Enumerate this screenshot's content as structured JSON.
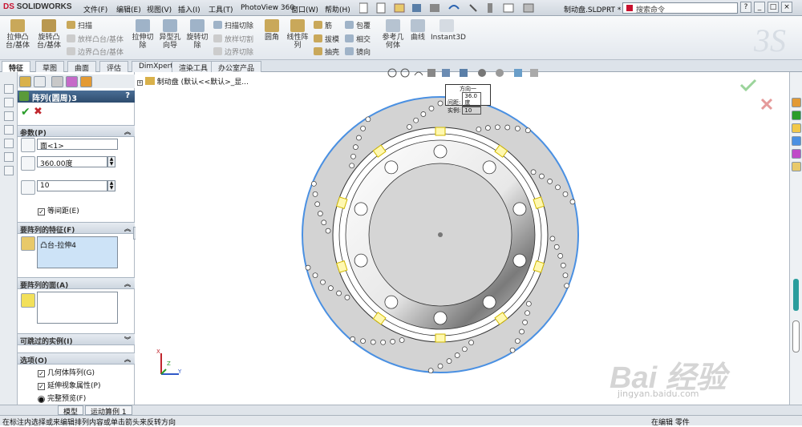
{
  "app": {
    "logo_ds": "DS",
    "logo": "SOLIDWORKS",
    "doc_title": "制动盘.SLDPRT *"
  },
  "menu": [
    "文件(F)",
    "编辑(E)",
    "视图(V)",
    "插入(I)",
    "工具(T)",
    "PhotoView 360",
    "窗口(W)",
    "帮助(H)"
  ],
  "search": {
    "placeholder": "搜索命令"
  },
  "window_buttons": [
    "?",
    "_",
    "□",
    "×"
  ],
  "ribbon": {
    "big": [
      "拉伸凸台/基体",
      "旋转凸台/基体",
      "拉伸切除",
      "异型孔向导",
      "旋转切除",
      "圆角",
      "线性阵列",
      "参考几何体",
      "曲线",
      "Instant3D"
    ],
    "small": [
      "扫描",
      "放样凸台/基体",
      "边界凸台/基体",
      "扫描切除",
      "放样切割",
      "边界切除",
      "筋",
      "包覆",
      "拔模",
      "相交",
      "抽壳",
      "镜向"
    ]
  },
  "tabs": [
    "特征",
    "草图",
    "曲面",
    "评估",
    "DimXpert",
    "渲染工具",
    "办公室产品"
  ],
  "tree_root": "制动盘 (默认<<默认>_显...",
  "panel": {
    "title": "阵列(圆周)3",
    "ok": "✔",
    "cancel": "✖",
    "help": "?",
    "params": {
      "header": "参数(P)",
      "axis": "面<1>",
      "angle": "360.00度",
      "count": "10",
      "equal_spacing": "等间距(E)"
    },
    "features": {
      "header": "要阵列的特征(F)",
      "item": "凸台-拉伸4"
    },
    "faces": {
      "header": "要阵列的面(A)"
    },
    "skipped": {
      "header": "可跳过的实例(I)"
    },
    "options": {
      "header": "选项(O)",
      "items": [
        "几何体阵列(G)",
        "延伸视象属性(P)",
        "完整预览(F)"
      ]
    }
  },
  "callout": {
    "title": "方向一",
    "spacing_label": "间距:",
    "spacing_value": "36.0度",
    "instances_label": "实例:",
    "instances_value": "10"
  },
  "triad": {
    "x": "X",
    "y": "Y",
    "z": "Z"
  },
  "bottom_tabs": [
    "模型",
    "运动算例 1"
  ],
  "status": {
    "left": "在标注内选择或来编辑排列内容或单击箭头来反转方向",
    "right": "在编辑 零件"
  },
  "watermark": {
    "brand": "Bai 经验",
    "url": "jingyan.baidu.com"
  },
  "colors": {
    "accent": "#2d4c6e",
    "disk": "#d3d3d3",
    "selection": "#4a90e2",
    "ok": "#2a9d2a",
    "cancel": "#c0262d"
  }
}
